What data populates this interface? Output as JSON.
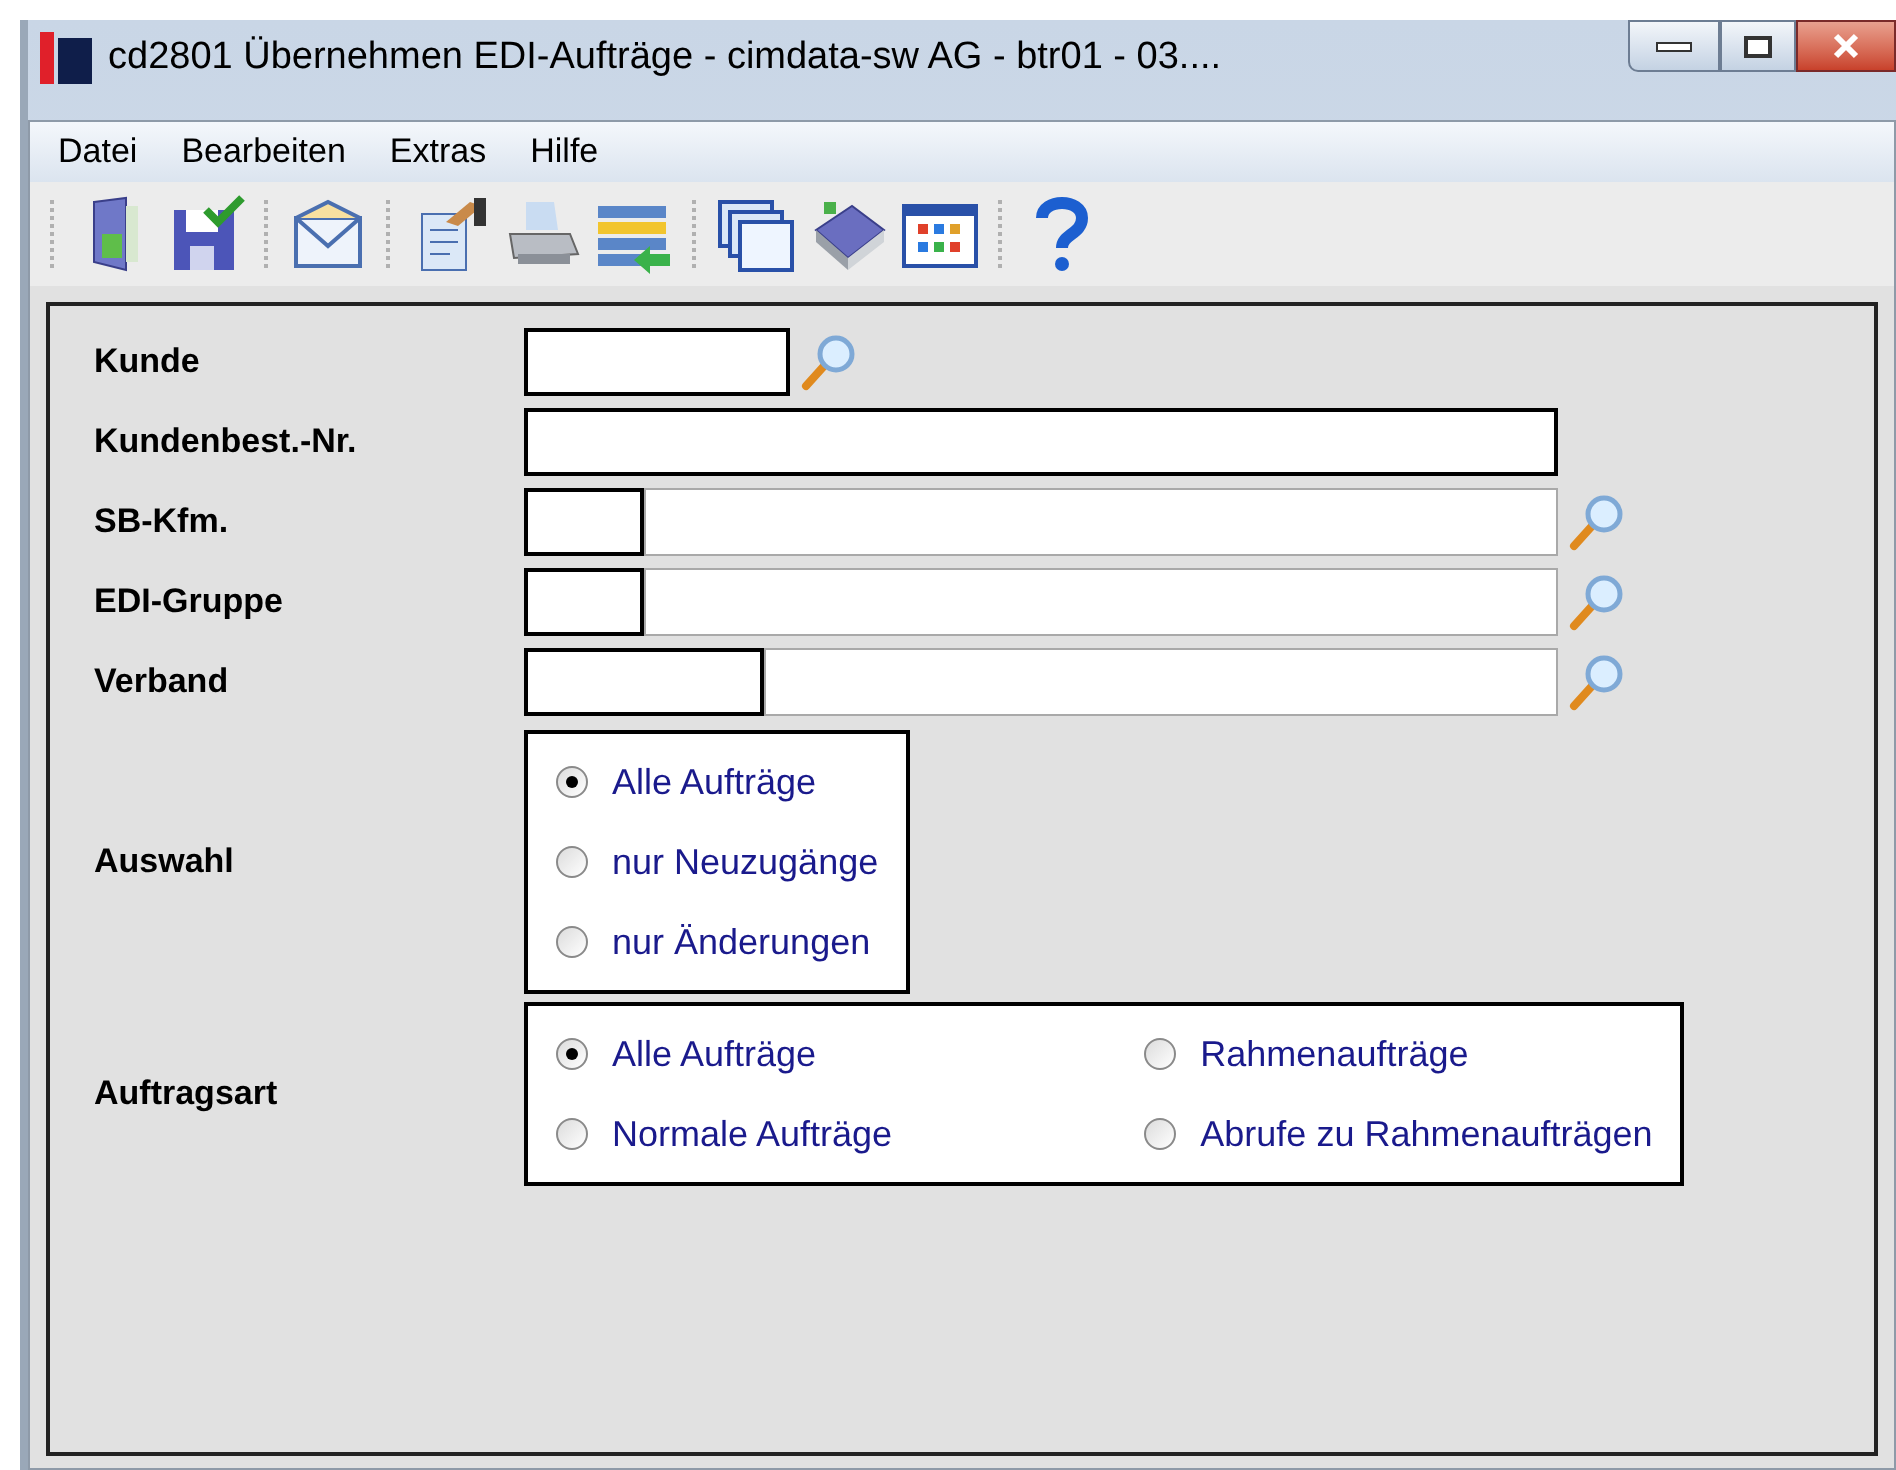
{
  "window": {
    "title": "cd2801 Übernehmen EDI-Aufträge - cimdata-sw AG - btr01 - 03...."
  },
  "menu": [
    "Datei",
    "Bearbeiten",
    "Extras",
    "Hilfe"
  ],
  "fields": [
    {
      "label": "Kunde",
      "kind": "short",
      "lookup": true
    },
    {
      "label": "Kundenbest.-Nr.",
      "kind": "wide",
      "lookup": false
    },
    {
      "label": "SB-Kfm.",
      "kind": "code-name",
      "lookup": true
    },
    {
      "label": "EDI-Gruppe",
      "kind": "code-name",
      "lookup": true
    },
    {
      "label": "Verband",
      "kind": "code-name-wide",
      "lookup": true
    }
  ],
  "radio_groups": [
    {
      "label": "Auswahl",
      "kind": "single-column",
      "options": [
        {
          "label": "Alle Aufträge",
          "selected": true
        },
        {
          "label": "nur Neuzugänge",
          "selected": false
        },
        {
          "label": "nur Änderungen",
          "selected": false
        }
      ]
    },
    {
      "label": "Auftragsart",
      "kind": "two-column",
      "options": [
        {
          "label": "Alle Aufträge",
          "selected": true
        },
        {
          "label": "Rahmenaufträge",
          "selected": false
        },
        {
          "label": "Normale Aufträge",
          "selected": false
        },
        {
          "label": "Abrufe zu Rahmenaufträgen",
          "selected": false
        }
      ]
    }
  ]
}
